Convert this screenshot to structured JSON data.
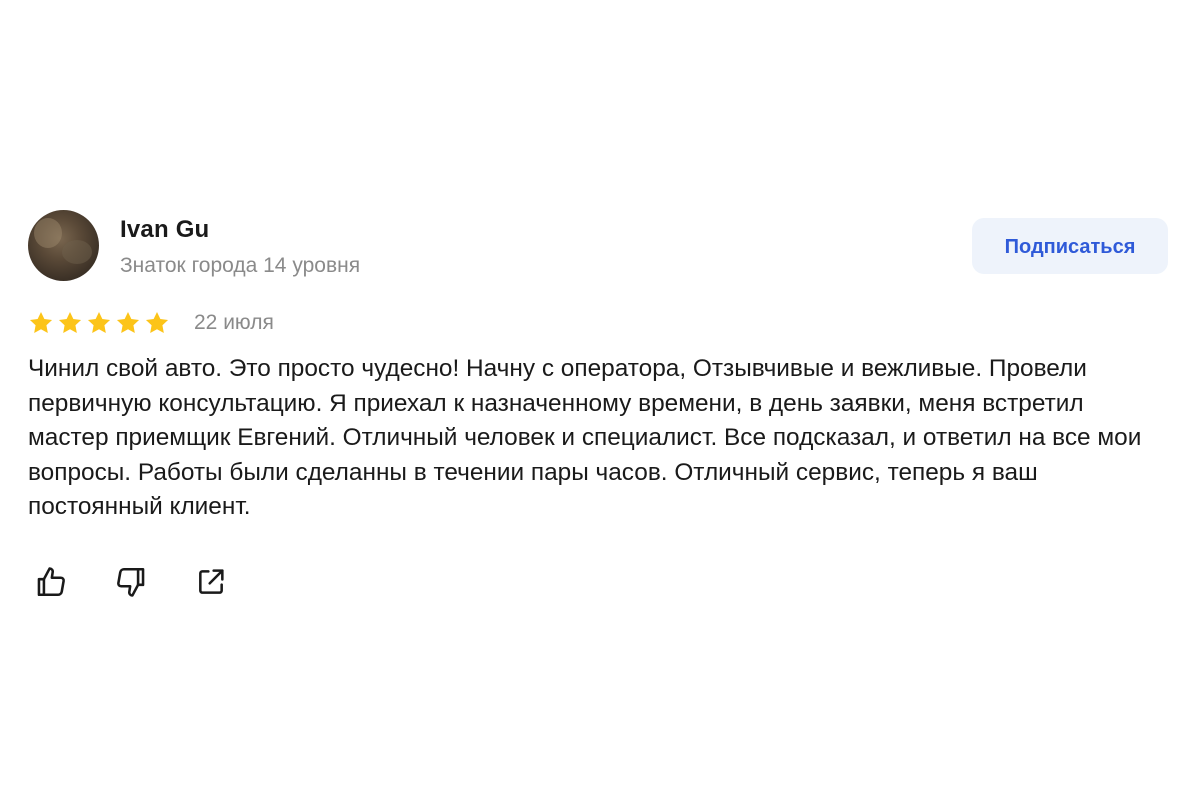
{
  "author": {
    "name": "Ivan Gu",
    "level": "Знаток города 14 уровня"
  },
  "subscribe": {
    "label": "Подписаться"
  },
  "rating": {
    "stars": 5,
    "max": 5,
    "star_color": "#fc3f1d"
  },
  "review": {
    "date": "22 июля",
    "text": "Чинил свой авто. Это просто чудесно! Начну с оператора, Отзывчивые и вежливые. Провели первичную консультацию. Я приехал к назначенному времени, в день заявки, меня встретил мастер приемщик Евгений. Отличный человек и специалист. Все подсказал, и ответил на все мои вопросы. Работы были сделанны в течении пары часов. Отличный сервис, теперь я ваш постоянный клиент."
  },
  "actions": [
    {
      "icon": "thumbs-up-icon"
    },
    {
      "icon": "thumbs-down-icon"
    },
    {
      "icon": "share-icon"
    }
  ],
  "colors": {
    "accent": "#2f5ad8",
    "button_bg": "#eef3fb",
    "star": "#fcc419",
    "muted_text": "#8a8a8a"
  }
}
